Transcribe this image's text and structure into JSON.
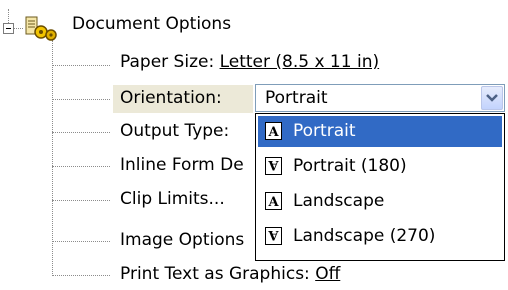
{
  "tree": {
    "root": {
      "label": "Document Options",
      "icon": "document-options-icon",
      "expander_icon": "collapse-minus-icon"
    },
    "items": {
      "paper_size": {
        "label": "Paper Size: ",
        "value": "Letter (8.5 x 11 in)"
      },
      "orientation": {
        "label": "Orientation:"
      },
      "output_type": {
        "label": "Output Type:"
      },
      "inline_form": {
        "label": "Inline Form De"
      },
      "clip_limits": {
        "label": "Clip Limits..."
      },
      "image_options": {
        "label": "Image Options"
      },
      "print_text": {
        "label": "Print Text as Graphics: ",
        "value": "Off"
      }
    }
  },
  "orientation_combo": {
    "value": "Portrait",
    "button_icon": "chevron-down-icon",
    "options": [
      {
        "label": "Portrait",
        "icon": "portrait-orientation-icon",
        "selected": true
      },
      {
        "label": "Portrait (180)",
        "icon": "portrait-180-orientation-icon",
        "selected": false
      },
      {
        "label": "Landscape",
        "icon": "landscape-orientation-icon",
        "selected": false
      },
      {
        "label": "Landscape (270)",
        "icon": "landscape-270-orientation-icon",
        "selected": false
      }
    ]
  },
  "colors": {
    "selection": "#316ac5",
    "combo_border": "#7f9db9",
    "row_highlight": "#ece9d8"
  }
}
